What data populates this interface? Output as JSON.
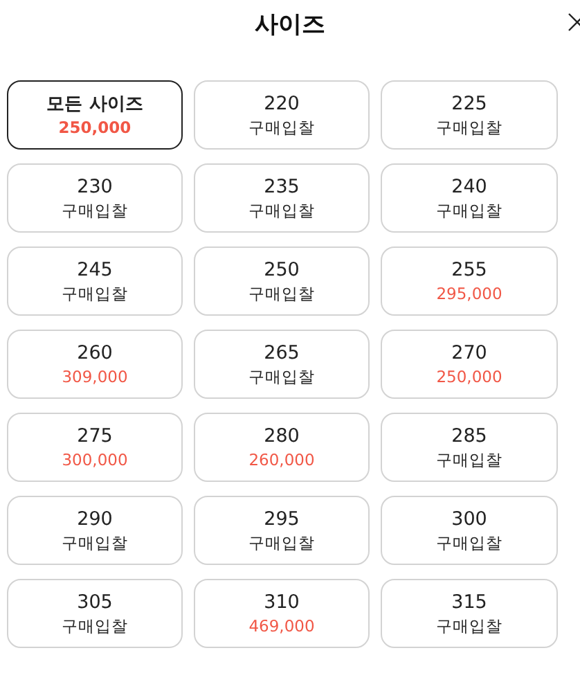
{
  "header": {
    "title": "사이즈"
  },
  "sizes": [
    {
      "label": "모든 사이즈",
      "sub": "250,000",
      "kind": "price",
      "selected": true
    },
    {
      "label": "220",
      "sub": "구매입찰",
      "kind": "bid",
      "selected": false
    },
    {
      "label": "225",
      "sub": "구매입찰",
      "kind": "bid",
      "selected": false
    },
    {
      "label": "230",
      "sub": "구매입찰",
      "kind": "bid",
      "selected": false
    },
    {
      "label": "235",
      "sub": "구매입찰",
      "kind": "bid",
      "selected": false
    },
    {
      "label": "240",
      "sub": "구매입찰",
      "kind": "bid",
      "selected": false
    },
    {
      "label": "245",
      "sub": "구매입찰",
      "kind": "bid",
      "selected": false
    },
    {
      "label": "250",
      "sub": "구매입찰",
      "kind": "bid",
      "selected": false
    },
    {
      "label": "255",
      "sub": "295,000",
      "kind": "price",
      "selected": false
    },
    {
      "label": "260",
      "sub": "309,000",
      "kind": "price",
      "selected": false
    },
    {
      "label": "265",
      "sub": "구매입찰",
      "kind": "bid",
      "selected": false
    },
    {
      "label": "270",
      "sub": "250,000",
      "kind": "price",
      "selected": false
    },
    {
      "label": "275",
      "sub": "300,000",
      "kind": "price",
      "selected": false
    },
    {
      "label": "280",
      "sub": "260,000",
      "kind": "price",
      "selected": false
    },
    {
      "label": "285",
      "sub": "구매입찰",
      "kind": "bid",
      "selected": false
    },
    {
      "label": "290",
      "sub": "구매입찰",
      "kind": "bid",
      "selected": false
    },
    {
      "label": "295",
      "sub": "구매입찰",
      "kind": "bid",
      "selected": false
    },
    {
      "label": "300",
      "sub": "구매입찰",
      "kind": "bid",
      "selected": false
    },
    {
      "label": "305",
      "sub": "구매입찰",
      "kind": "bid",
      "selected": false
    },
    {
      "label": "310",
      "sub": "469,000",
      "kind": "price",
      "selected": false
    },
    {
      "label": "315",
      "sub": "구매입찰",
      "kind": "bid",
      "selected": false
    }
  ]
}
